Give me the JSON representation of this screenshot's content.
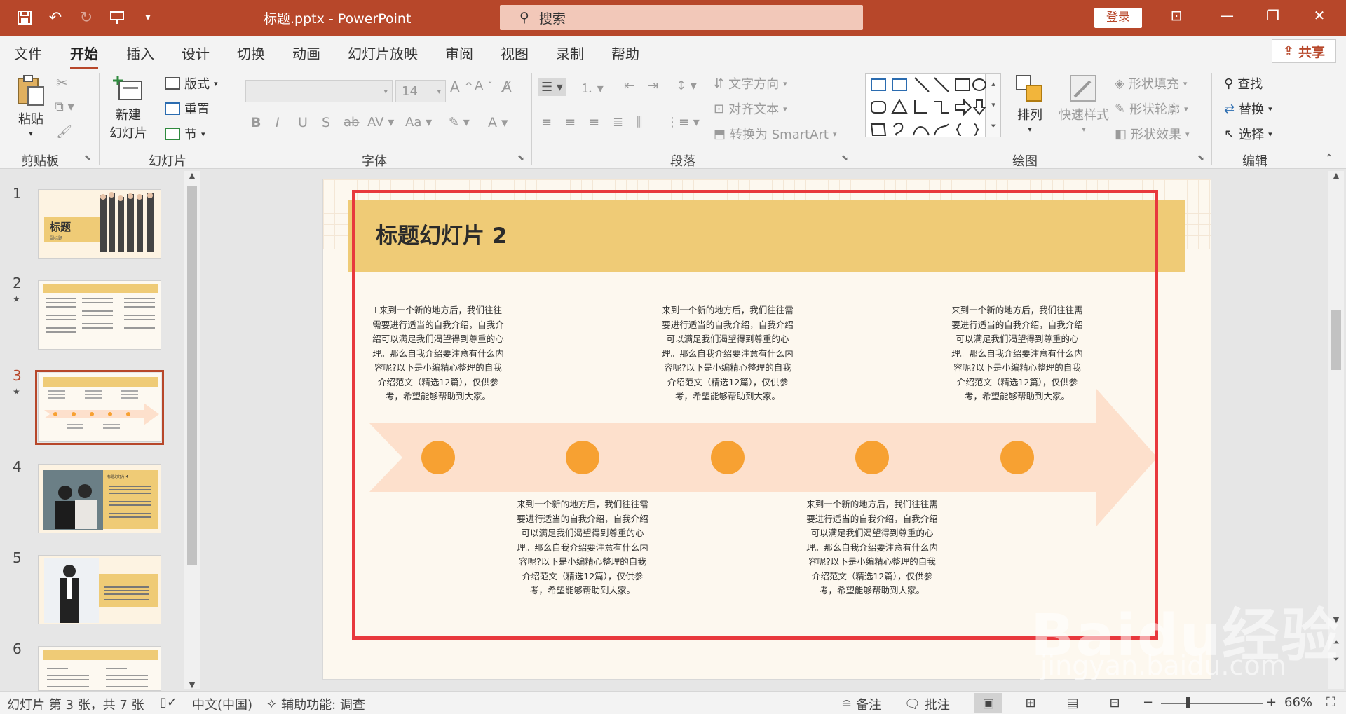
{
  "window": {
    "doc_title": "标题.pptx  -  PowerPoint",
    "search_placeholder": "搜索",
    "login_label": "登录"
  },
  "menu": {
    "tabs": [
      "文件",
      "开始",
      "插入",
      "设计",
      "切换",
      "动画",
      "幻灯片放映",
      "审阅",
      "视图",
      "录制",
      "帮助"
    ],
    "active_tab": "开始",
    "share_label": "共享"
  },
  "ribbon": {
    "clipboard": {
      "paste": "粘贴",
      "label": "剪贴板"
    },
    "slides": {
      "new_slide_1": "新建",
      "new_slide_2": "幻灯片",
      "layout": "版式",
      "reset": "重置",
      "section": "节",
      "label": "幻灯片"
    },
    "font": {
      "size": "14",
      "label": "字体"
    },
    "paragraph": {
      "text_direction": "文字方向",
      "align_text": "对齐文本",
      "smartart": "转换为 SmartArt",
      "label": "段落"
    },
    "drawing": {
      "arrange": "排列",
      "quick_styles": "快速样式",
      "shape_fill": "形状填充",
      "shape_outline": "形状轮廓",
      "shape_effects": "形状效果",
      "label": "绘图"
    },
    "editing": {
      "find": "查找",
      "replace": "替换",
      "select": "选择",
      "label": "编辑"
    }
  },
  "thumbnails": {
    "numbers": [
      "1",
      "2",
      "3",
      "4",
      "5",
      "6"
    ],
    "current": "3",
    "slide1_title": "标题",
    "slide1_sub": "副标题",
    "slide_heading": "标题幻灯片 4"
  },
  "slide": {
    "title": "标题幻灯片 2",
    "text_first": "L来到一个新的地方后，我们往往需要进行适当的自我介绍，自我介绍可以满足我们渴望得到尊重的心理。那么自我介绍要注意有什么内容呢?以下是小编精心整理的自我介绍范文（精选12篇），仅供参考，希望能够帮助到大家。",
    "text_other": "来到一个新的地方后，我们往往需要进行适当的自我介绍，自我介绍可以满足我们渴望得到尊重的心理。那么自我介绍要注意有什么内容呢?以下是小编精心整理的自我介绍范文（精选12篇），仅供参考，希望能够帮助到大家。",
    "colors": {
      "band": "#efcb76",
      "arrow": "#fde0cc",
      "dot": "#f7a132",
      "frame": "#e8383d"
    }
  },
  "status": {
    "slide_info": "幻灯片 第 3 张，共 7 张",
    "language": "中文(中国)",
    "accessibility": "辅助功能: 调查",
    "notes": "备注",
    "comments": "批注",
    "zoom": "66%"
  },
  "watermark": {
    "brand": "Baidu经验",
    "url": "jingyan.baidu.com"
  }
}
